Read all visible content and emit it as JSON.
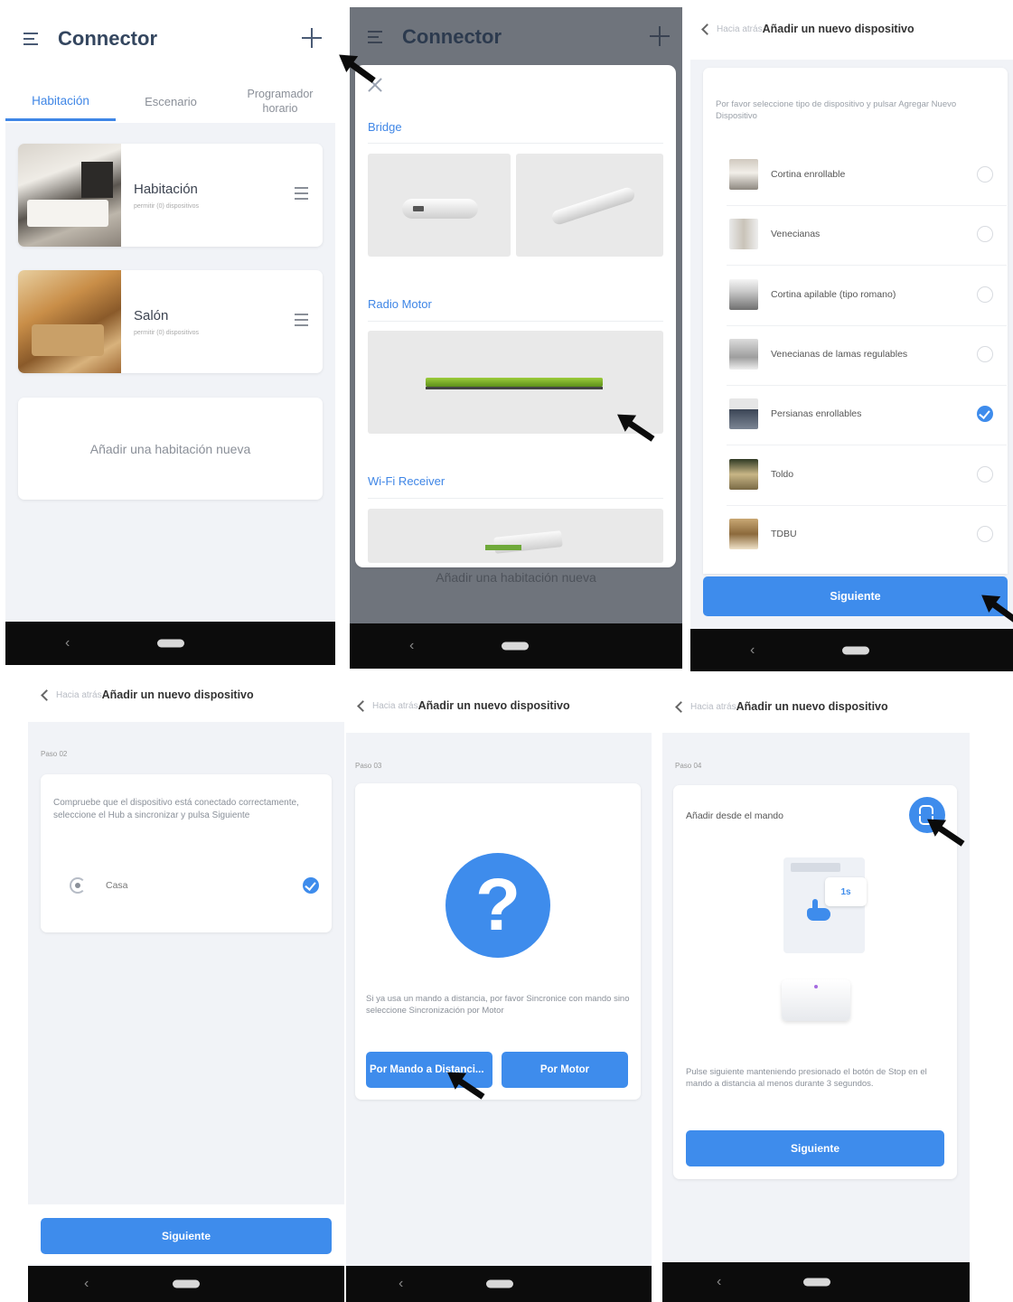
{
  "screen1": {
    "title": "Connector",
    "tabs": [
      "Habitación",
      "Escenario",
      "Programador horario"
    ],
    "rooms": [
      {
        "name": "Habitación",
        "sub": "permitir (0) dispositivos"
      },
      {
        "name": "Salón",
        "sub": "permitir (0) dispositivos"
      }
    ],
    "add_room": "Añadir una habitación nueva"
  },
  "screen2": {
    "title": "Connector",
    "sections": [
      "Bridge",
      "Radio Motor",
      "Wi-Fi Receiver"
    ],
    "add_room": "Añadir una habitación nueva"
  },
  "screen3": {
    "back": "Hacia atrás",
    "title": "Añadir un nuevo dispositivo",
    "instruction": "Por favor seleccione tipo de dispositivo y pulsar Agregar Nuevo Dispositivo",
    "types": [
      {
        "label": "Cortina enrollable",
        "checked": false
      },
      {
        "label": "Venecianas",
        "checked": false
      },
      {
        "label": "Cortina apilable (tipo romano)",
        "checked": false
      },
      {
        "label": "Venecianas de lamas regulables",
        "checked": false
      },
      {
        "label": "Persianas enrollables",
        "checked": true
      },
      {
        "label": "Toldo",
        "checked": false
      },
      {
        "label": "TDBU",
        "checked": false
      }
    ],
    "next": "Siguiente"
  },
  "screen4": {
    "back": "Hacia atrás",
    "title": "Añadir un nuevo dispositivo",
    "step": "Paso 02",
    "instruction": "Compruebe que el dispositivo está conectado correctamente, seleccione el Hub a sincronizar y pulsa Siguiente",
    "hub": "Casa",
    "next": "Siguiente"
  },
  "screen5": {
    "back": "Hacia atrás",
    "title": "Añadir un nuevo dispositivo",
    "step": "Paso 03",
    "qmark": "?",
    "instruction": "Si ya usa un mando a distancia, por favor Sincronice con mando sino seleccione Sincronización por Motor",
    "btn_remote": "Por Mando a Distanci...",
    "btn_motor": "Por Motor"
  },
  "screen6": {
    "back": "Hacia atrás",
    "title": "Añadir un nuevo dispositivo",
    "step": "Paso 04",
    "heading": "Añadir desde el mando",
    "badge": "1s",
    "instruction": "Pulse siguiente manteniendo presionado el botón de Stop en el mando a distancia al menos durante 3 segundos.",
    "next": "Siguiente"
  },
  "nav": {
    "back_glyph": "‹"
  },
  "colors": {
    "accent": "#3e8cec",
    "nav": "#0c0c0c",
    "bg": "#f1f3f7"
  }
}
